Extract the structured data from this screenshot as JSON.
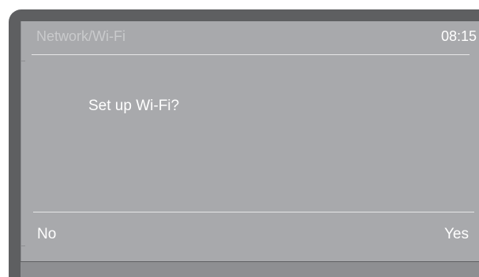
{
  "screen": {
    "title": "Network/Wi-Fi",
    "clock": "08:15",
    "prompt": "Set up Wi-Fi?",
    "softkeys": {
      "left_label": "No",
      "right_label": "Yes"
    }
  },
  "colors": {
    "device_frame": "#5e5f61",
    "screen_background": "#a8a9ac",
    "text_primary": "#ffffff",
    "text_dimmed": "#c9cacc"
  }
}
